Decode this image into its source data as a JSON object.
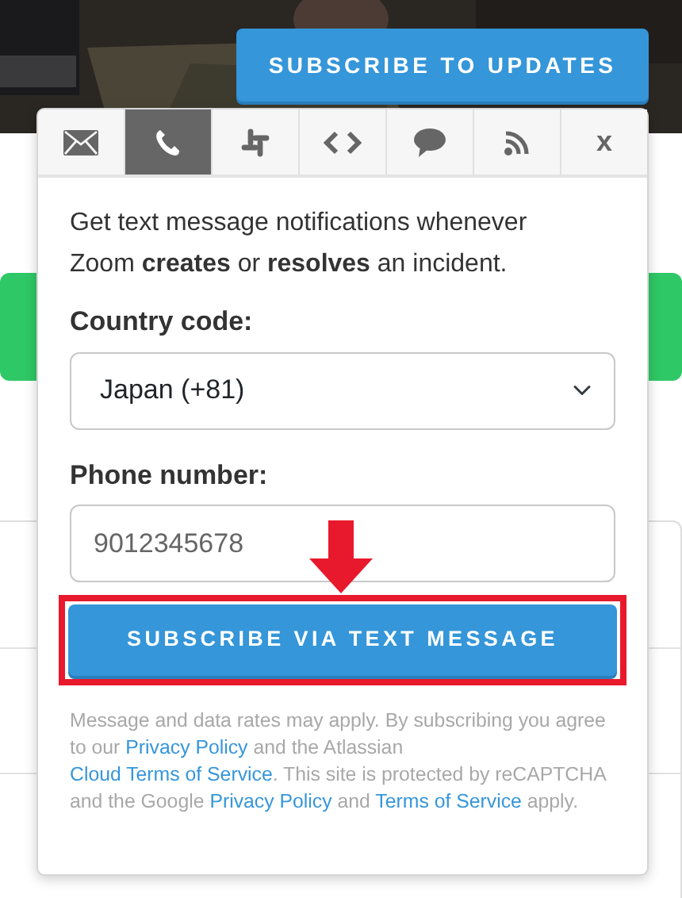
{
  "header": {
    "subscribe_button": "SUBSCRIBE TO UPDATES"
  },
  "popup": {
    "tabs": [
      {
        "kind": "email",
        "selected": false
      },
      {
        "kind": "sms",
        "selected": true
      },
      {
        "kind": "slack",
        "selected": false
      },
      {
        "kind": "webhook",
        "selected": false
      },
      {
        "kind": "chat",
        "selected": false
      },
      {
        "kind": "rss",
        "selected": false
      },
      {
        "kind": "close",
        "label": "x",
        "selected": false
      }
    ],
    "intro": "Get text message notifications whenever Zoom **creates** or **resolves** an incident.",
    "country_label": "Country code:",
    "country_value": "Japan (+81)",
    "phone_label": "Phone number:",
    "phone_value": "9012345678",
    "submit_button": "SUBSCRIBE VIA TEXT MESSAGE",
    "highlighted": true,
    "arrow": true,
    "legal": [
      {
        "kind": "text",
        "text": "Message and data rates may apply. By subscribing you agree to our "
      },
      {
        "kind": "link",
        "text": "Privacy Policy"
      },
      {
        "kind": "text",
        "text": " and the Atlassian "
      },
      {
        "kind": "link",
        "text": "Cloud Terms of Service"
      },
      {
        "kind": "text",
        "text": ". This site is protected by reCAPTCHA and the Google "
      },
      {
        "kind": "link",
        "text": "Privacy Policy"
      },
      {
        "kind": "text",
        "text": " and "
      },
      {
        "kind": "link",
        "text": "Terms of Service"
      },
      {
        "kind": "text",
        "text": " apply."
      }
    ]
  }
}
